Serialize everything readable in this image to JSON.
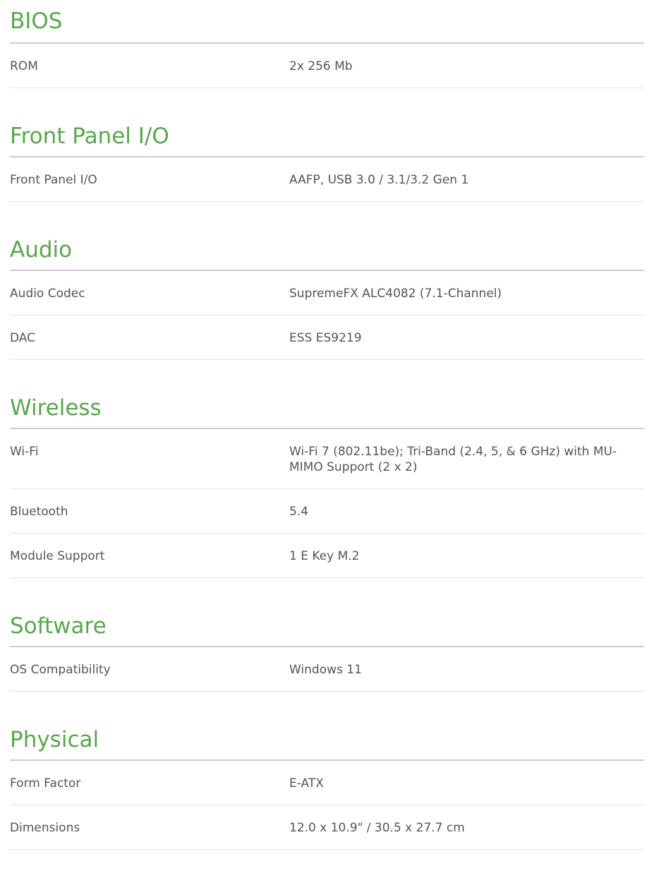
{
  "sections": [
    {
      "title": "BIOS",
      "rows": [
        {
          "label": "ROM",
          "value": "2x 256 Mb"
        }
      ]
    },
    {
      "title": "Front Panel I/O",
      "rows": [
        {
          "label": "Front Panel I/O",
          "value": "AAFP, USB 3.0 / 3.1/3.2 Gen 1"
        }
      ]
    },
    {
      "title": "Audio",
      "rows": [
        {
          "label": "Audio Codec",
          "value": "SupremeFX ALC4082 (7.1-Channel)"
        },
        {
          "label": "DAC",
          "value": "ESS ES9219"
        }
      ]
    },
    {
      "title": "Wireless",
      "rows": [
        {
          "label": "Wi-Fi",
          "value": "Wi-Fi 7 (802.11be); Tri-Band (2.4, 5, & 6 GHz) with MU-MIMO Support (2 x 2)"
        },
        {
          "label": "Bluetooth",
          "value": "5.4"
        },
        {
          "label": "Module Support",
          "value": "1 E Key M.2"
        }
      ]
    },
    {
      "title": "Software",
      "rows": [
        {
          "label": "OS Compatibility",
          "value": "Windows 11"
        }
      ]
    },
    {
      "title": "Physical",
      "rows": [
        {
          "label": "Form Factor",
          "value": "E-ATX"
        },
        {
          "label": "Dimensions",
          "value": "12.0 x 10.9\" / 30.5 x 27.7 cm"
        }
      ]
    }
  ],
  "colors": {
    "heading": "#5aa64e",
    "text": "#555555",
    "heading_rule": "#cccccc",
    "row_rule": "#e3e3e3"
  }
}
